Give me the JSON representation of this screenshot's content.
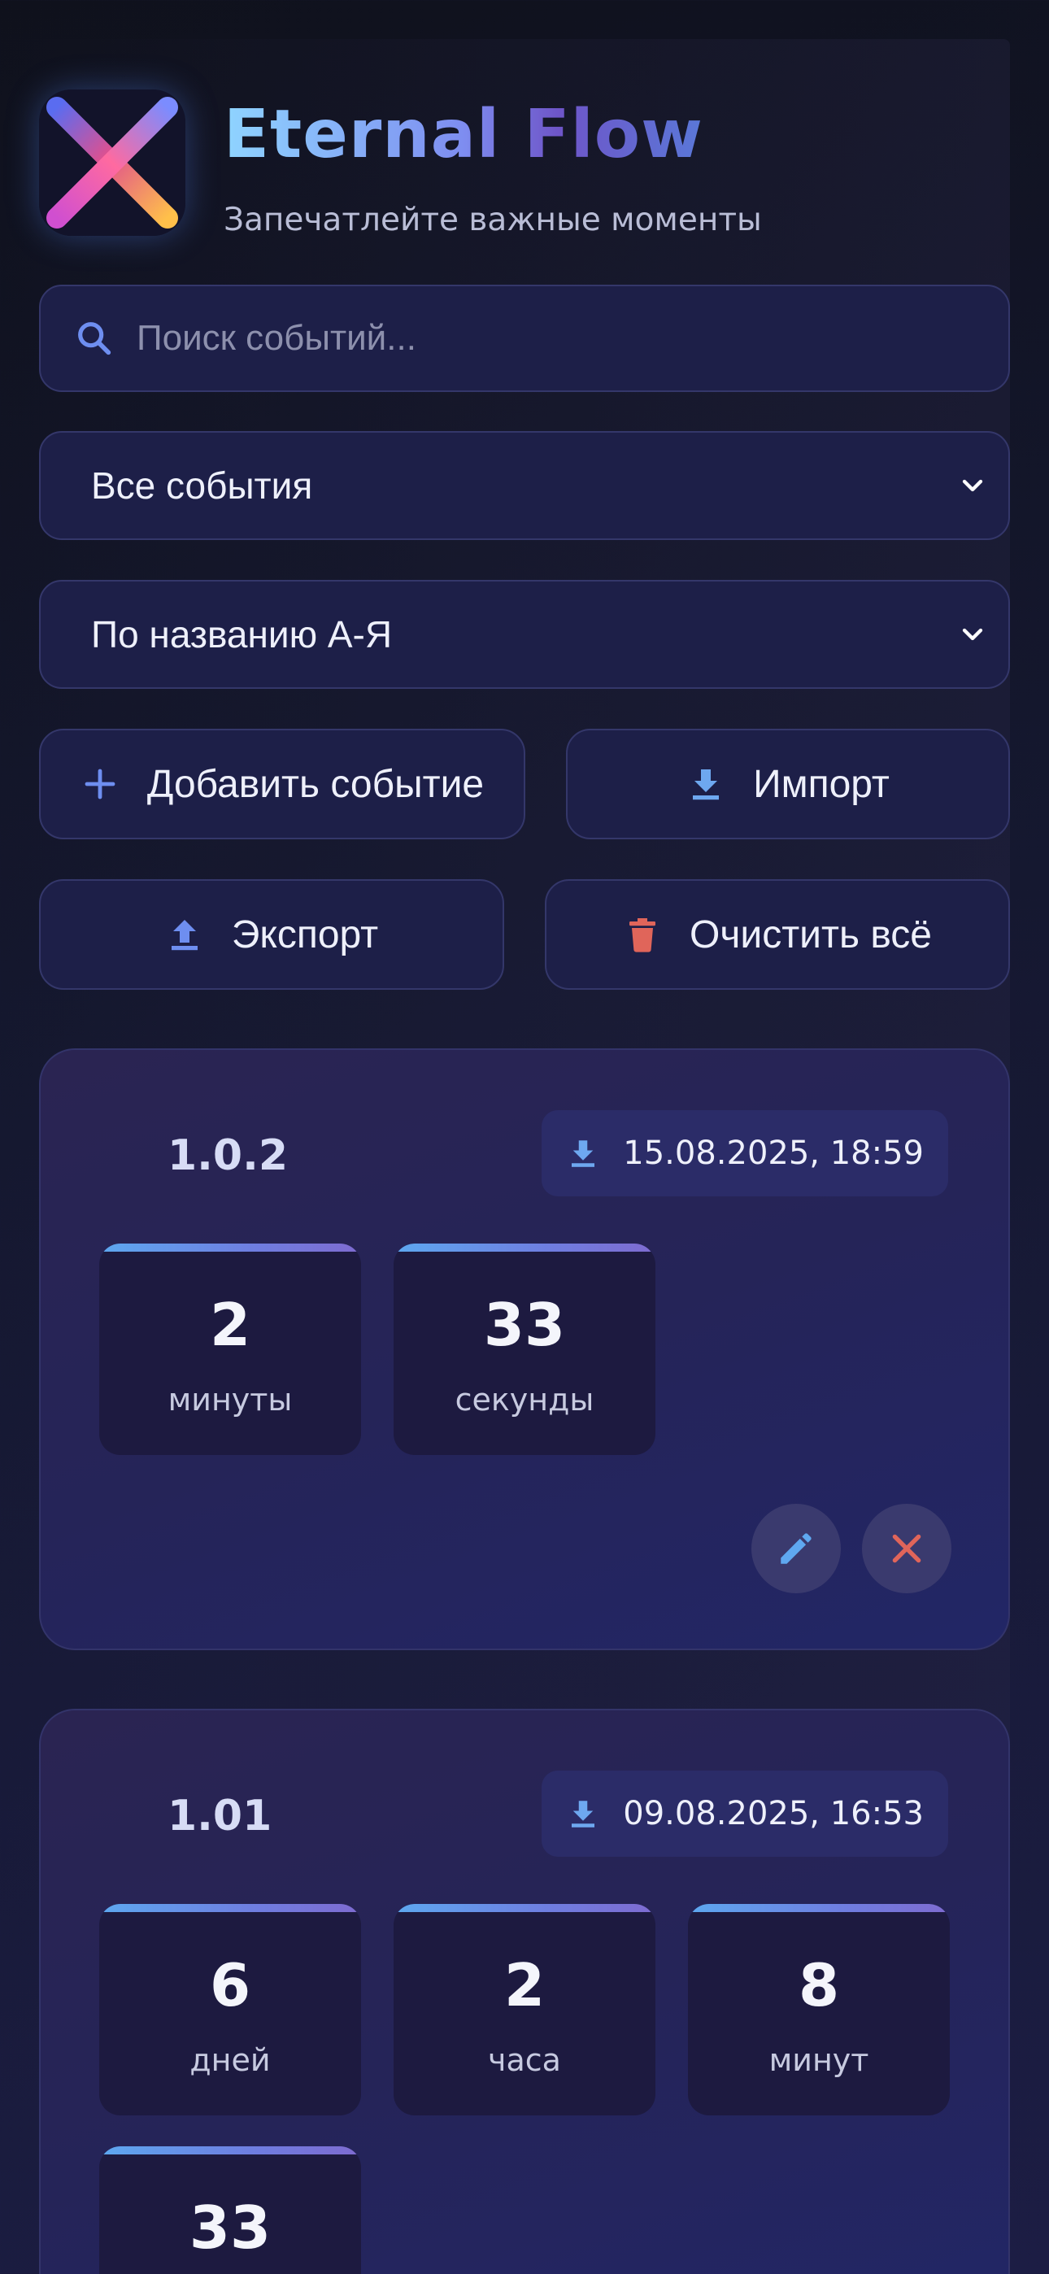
{
  "header": {
    "title": "Eternal Flow",
    "subtitle": "Запечатлейте важные моменты"
  },
  "search": {
    "placeholder": "Поиск событий...",
    "value": ""
  },
  "filters": {
    "category_selected": "Все события",
    "sort_selected": "По названию А-Я"
  },
  "toolbar": {
    "add_label": "Добавить событие",
    "import_label": "Импорт",
    "export_label": "Экспорт",
    "clear_label": "Очистить всё"
  },
  "events": [
    {
      "title": "1.0.2",
      "date": "15.08.2025, 18:59",
      "units": [
        {
          "value": "2",
          "label": "минуты"
        },
        {
          "value": "33",
          "label": "секунды"
        }
      ]
    },
    {
      "title": "1.01",
      "date": "09.08.2025, 16:53",
      "units": [
        {
          "value": "6",
          "label": "дней"
        },
        {
          "value": "2",
          "label": "часа"
        },
        {
          "value": "8",
          "label": "минут"
        },
        {
          "value": "33",
          "label": ""
        }
      ]
    }
  ],
  "icons": {
    "search": "search-icon",
    "chevron": "chevron-down-icon",
    "add": "plus-icon",
    "import": "download-icon",
    "export": "upload-icon",
    "clear": "trash-icon",
    "edit": "pencil-icon",
    "delete": "close-icon"
  },
  "colors": {
    "accent_blue": "#5da8f0",
    "accent_purple": "#7e6bd0",
    "danger": "#e0655a",
    "background": "#151830"
  }
}
